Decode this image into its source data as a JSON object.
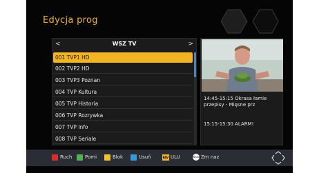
{
  "window": {
    "title": "Edycja prog"
  },
  "list": {
    "header": "WSZ TV",
    "prev_arrow": "<",
    "next_arrow": ">",
    "channels": [
      "001 TVP1 HD",
      "002 TVP2 HD",
      "003 TVP3 Poznan",
      "004 TVP Kultura",
      "005 TVP Historia",
      "006 TVP Rozrywka",
      "007 TVP Info",
      "008 TVP Seriale"
    ],
    "selected_index": 0
  },
  "epg": {
    "current": "14:45-15:15 Okrasa łamie\nprzepisy - Mięsne prz",
    "next": "15:15-15:30 ALARM!"
  },
  "footer": {
    "red": "Ruch",
    "green": "Pomi",
    "yellow": "Blok",
    "blue": "Usuń",
    "fav_icon": "FAV",
    "fav": "ULU",
    "recall_icon": "RECALL",
    "recall": "Zm naz"
  },
  "colors": {
    "accent": "#f3b423",
    "red": "#e5262d",
    "green": "#4cb748",
    "yellow": "#f6c21b",
    "blue": "#2d9de0",
    "background": "#050505"
  },
  "icons": {
    "nav": "navigation-diamond-icon",
    "decoration": "hexagon-icon"
  }
}
